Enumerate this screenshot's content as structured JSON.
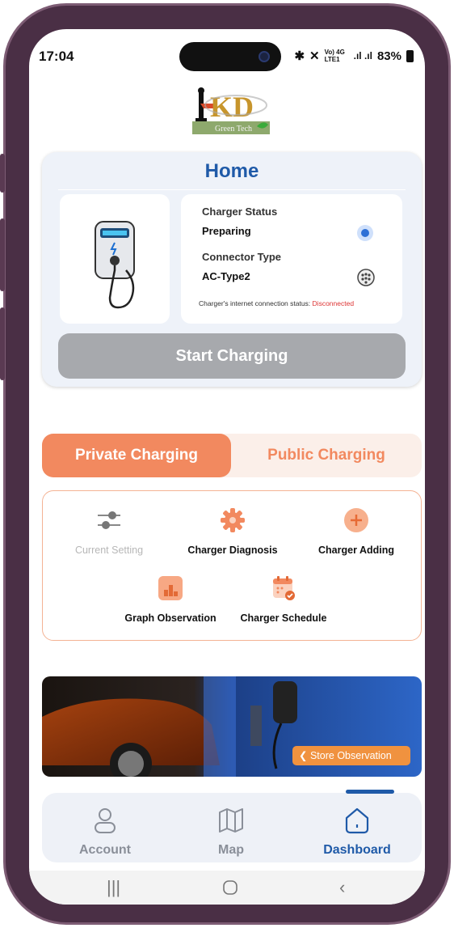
{
  "status_bar": {
    "time": "17:04",
    "network": "Vo) 4G LTE1",
    "battery": "83%"
  },
  "logo": {
    "text": "KD",
    "subtitle": "Green Tech"
  },
  "home": {
    "title": "Home",
    "charger_status_label": "Charger Status",
    "charger_status_value": "Preparing",
    "connector_type_label": "Connector Type",
    "connector_type_value": "AC-Type2",
    "internet_status_label": "Charger's internet connection status:",
    "internet_status_value": "Disconnected",
    "start_button": "Start Charging"
  },
  "tabs": {
    "private": "Private Charging",
    "public": "Public Charging",
    "active": "private"
  },
  "features": [
    {
      "label": "Current Setting",
      "icon": "sliders-icon",
      "enabled": false
    },
    {
      "label": "Charger Diagnosis",
      "icon": "gear-icon",
      "enabled": true
    },
    {
      "label": "Charger Adding",
      "icon": "plus-circle-icon",
      "enabled": true
    },
    {
      "label": "Graph Observation",
      "icon": "bar-chart-icon",
      "enabled": true
    },
    {
      "label": "Charger Schedule",
      "icon": "calendar-check-icon",
      "enabled": true
    }
  ],
  "banner": {
    "button": "Store Observation"
  },
  "bottom_nav": {
    "account": "Account",
    "map": "Map",
    "dashboard": "Dashboard",
    "active": "dashboard"
  },
  "colors": {
    "accent_blue": "#1f5aa8",
    "accent_orange": "#f2895f",
    "disconnected_red": "#d33333"
  }
}
